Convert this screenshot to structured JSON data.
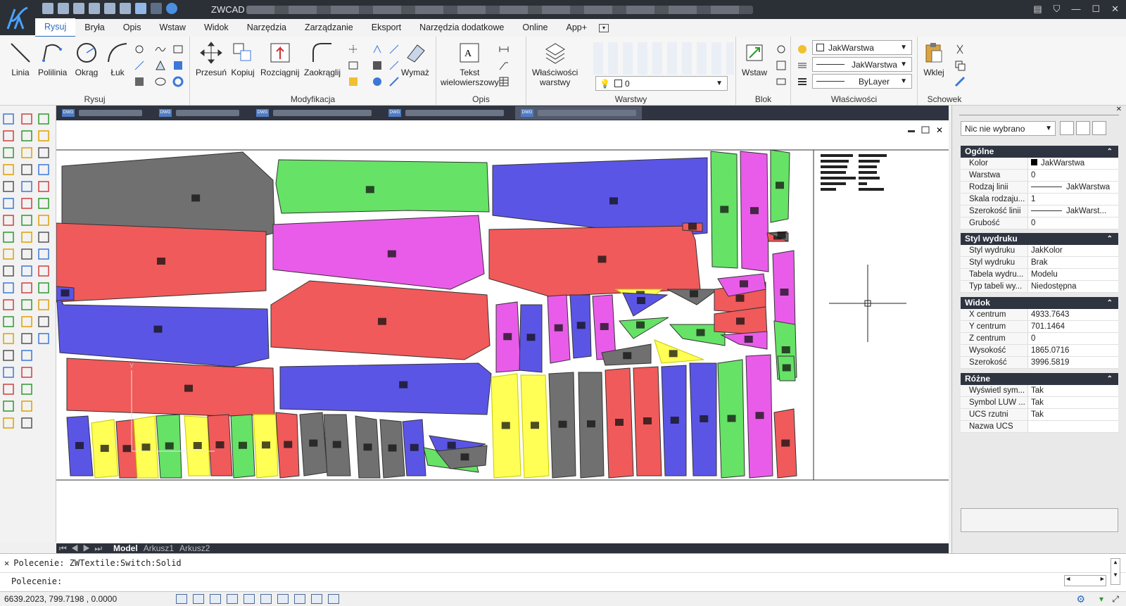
{
  "titlebar": {
    "app_name": "ZWCAD"
  },
  "menu_tabs": [
    "Rysuj",
    "Bryła",
    "Opis",
    "Wstaw",
    "Widok",
    "Narzędzia",
    "Zarządzanie",
    "Eksport",
    "Narzędzia dodatkowe",
    "Online",
    "App+"
  ],
  "ribbon": {
    "groups": {
      "draw": "Rysuj",
      "modify": "Modyfikacja",
      "annotate": "Opis",
      "layers": "Warstwy",
      "block": "Blok",
      "properties": "Właściwości",
      "clipboard": "Schowek"
    },
    "buttons": {
      "line": "Linia",
      "polyline": "Polilinia",
      "circle": "Okrąg",
      "arc": "Łuk",
      "move": "Przesuń",
      "copy": "Kopiuj",
      "stretch": "Rozciągnij",
      "fillet": "Zaokrąglij",
      "erase": "Wymaż",
      "mtext_1": "Tekst",
      "mtext_2": "wielowierszowy",
      "layer_props_1": "Właściwości",
      "layer_props_2": "warstwy",
      "insert": "Wstaw",
      "paste": "Wklej"
    },
    "layer_dropdown": "0",
    "color_dropdown": "JakWarstwa",
    "linetype_dropdown": "JakWarstwa",
    "lineweight_dropdown": "ByLayer"
  },
  "properties": {
    "selection": "Nic nie wybrano",
    "sections": [
      {
        "title": "Ogólne",
        "rows": [
          {
            "k": "Kolor",
            "v": "JakWarstwa"
          },
          {
            "k": "Warstwa",
            "v": "0"
          },
          {
            "k": "Rodzaj linii",
            "v": "JakWarstwa"
          },
          {
            "k": "Skala rodzaju...",
            "v": "1"
          },
          {
            "k": "Szerokość linii",
            "v": "JakWarst..."
          },
          {
            "k": "Grubość",
            "v": "0"
          }
        ]
      },
      {
        "title": "Styl wydruku",
        "rows": [
          {
            "k": "Styl wydruku",
            "v": "JakKolor"
          },
          {
            "k": "Styl wydruku",
            "v": "Brak"
          },
          {
            "k": "Tabela wydru...",
            "v": "Modelu"
          },
          {
            "k": "Typ tabeli wy...",
            "v": "Niedostępna"
          }
        ]
      },
      {
        "title": "Widok",
        "rows": [
          {
            "k": "X centrum",
            "v": "4933.7643"
          },
          {
            "k": "Y centrum",
            "v": "701.1464"
          },
          {
            "k": "Z centrum",
            "v": "0"
          },
          {
            "k": "Wysokość",
            "v": "1865.0716"
          },
          {
            "k": "Szerokość",
            "v": "3996.5819"
          }
        ]
      },
      {
        "title": "Różne",
        "rows": [
          {
            "k": "Wyświetl sym...",
            "v": "Tak"
          },
          {
            "k": "Symbol LUW ...",
            "v": "Tak"
          },
          {
            "k": "UCS rzutni",
            "v": "Tak"
          },
          {
            "k": "Nazwa UCS",
            "v": ""
          }
        ]
      }
    ]
  },
  "layout_tabs": {
    "model": "Model",
    "sheet1": "Arkusz1",
    "sheet2": "Arkusz2"
  },
  "command": {
    "history": "Polecenie: ZWTextile:Switch:Solid",
    "prompt": "Polecenie:"
  },
  "status": {
    "coords": "6639.2023, 799.7198 , 0.0000"
  },
  "colors": {
    "red": "#f05a5a",
    "blue": "#5b55e6",
    "green": "#66e266",
    "magenta": "#e95ce9",
    "gray": "#707070",
    "yellow": "#ffff55"
  }
}
